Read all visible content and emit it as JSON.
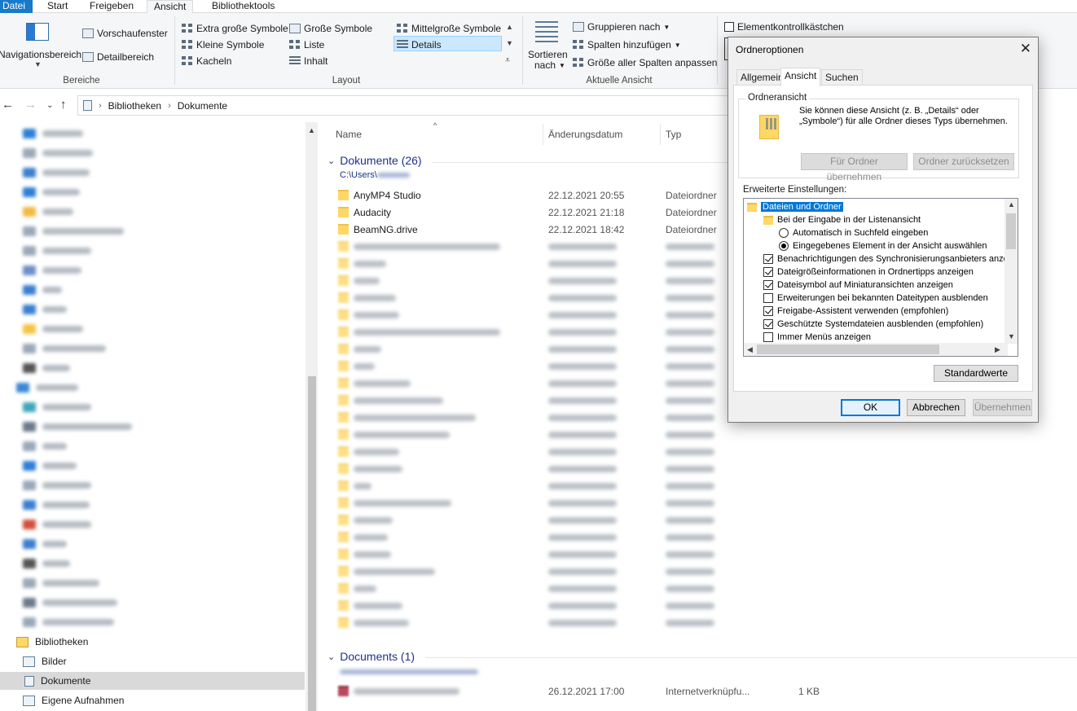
{
  "ribbon": {
    "tabs": [
      "Datei",
      "Start",
      "Freigeben",
      "Ansicht",
      "Bibliothektools"
    ],
    "groups": {
      "bereiche": {
        "label": "Bereiche",
        "navigationsbereich": "Navigationsbereich",
        "vorschaufenster": "Vorschaufenster",
        "detailbereich": "Detailbereich"
      },
      "layout": {
        "label": "Layout",
        "items": [
          "Extra große Symbole",
          "Große Symbole",
          "Mittelgroße Symbole",
          "Kleine Symbole",
          "Liste",
          "Details",
          "Kacheln",
          "Inhalt"
        ]
      },
      "aktuelle_ansicht": {
        "label": "Aktuelle Ansicht",
        "sortieren": "Sortieren",
        "sortieren2": "nach",
        "gruppieren": "Gruppieren nach",
        "spalten": "Spalten hinzufügen",
        "groesse": "Größe aller Spalten anpassen"
      },
      "anzeigen": {
        "elementkontrollkaestchen": "Elementkontrollkästchen"
      }
    }
  },
  "address": {
    "crumbs": [
      "Bibliotheken",
      "Dokumente"
    ]
  },
  "navpane": {
    "bibliotheken": "Bibliotheken",
    "items": [
      "Bilder",
      "Dokumente",
      "Eigene Aufnahmen"
    ]
  },
  "filelist": {
    "columns": {
      "name": "Name",
      "date": "Änderungsdatum",
      "type": "Typ"
    },
    "group1": {
      "title": "Dokumente (26)",
      "path": "C:\\Users\\"
    },
    "group1_files": [
      {
        "name": "AnyMP4 Studio",
        "date": "22.12.2021 20:55",
        "type": "Dateiordner"
      },
      {
        "name": "Audacity",
        "date": "22.12.2021 21:18",
        "type": "Dateiordner"
      },
      {
        "name": "BeamNG.drive",
        "date": "22.12.2021 18:42",
        "type": "Dateiordner"
      }
    ],
    "group2": {
      "title": "Documents (1)"
    },
    "group2_file": {
      "date": "26.12.2021 17:00",
      "type": "Internetverknüpfu...",
      "size": "1 KB"
    }
  },
  "dialog": {
    "title": "Ordneroptionen",
    "tabs": [
      "Allgemein",
      "Ansicht",
      "Suchen"
    ],
    "ordneransicht": {
      "legend": "Ordneransicht",
      "desc": "Sie können diese Ansicht (z. B. „Details“ oder „Symbole“) für alle Ordner dieses Typs übernehmen.",
      "btn_apply": "Für Ordner übernehmen",
      "btn_reset": "Ordner zurücksetzen"
    },
    "advanced_label": "Erweiterte Einstellungen:",
    "tree": {
      "root": "Dateien und Ordner",
      "sub": "Bei der Eingabe in der Listenansicht",
      "radio1": "Automatisch in Suchfeld eingeben",
      "radio2": "Eingegebenes Element in der Ansicht auswählen",
      "checks": [
        {
          "label": "Benachrichtigungen des Synchronisierungsanbieters anzeig",
          "checked": true
        },
        {
          "label": "Dateigrößeinformationen in Ordnertipps anzeigen",
          "checked": true
        },
        {
          "label": "Dateisymbol auf Miniaturansichten anzeigen",
          "checked": true
        },
        {
          "label": "Erweiterungen bei bekannten Dateitypen ausblenden",
          "checked": false
        },
        {
          "label": "Freigabe-Assistent verwenden (empfohlen)",
          "checked": true
        },
        {
          "label": "Geschützte Systemdateien ausblenden (empfohlen)",
          "checked": true
        },
        {
          "label": "Immer Menüs anzeigen",
          "checked": false
        }
      ]
    },
    "btn_defaults": "Standardwerte",
    "btn_ok": "OK",
    "btn_cancel": "Abbrechen",
    "btn_apply": "Übernehmen"
  },
  "colors": {
    "accent": "#0078d7",
    "file_tab": "#1979ca",
    "group_header": "#1e3287",
    "folder": "#ffd766"
  }
}
